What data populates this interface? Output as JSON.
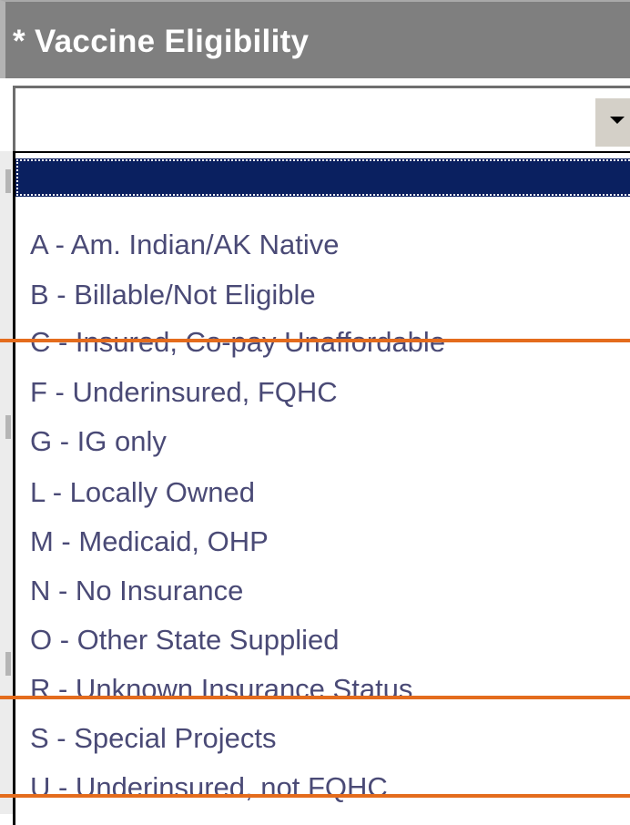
{
  "header": {
    "title": "* Vaccine Eligibility"
  },
  "select": {
    "value": "",
    "options": [
      {
        "label": "",
        "selected": true,
        "struck": false
      },
      {
        "label": "A - Am. Indian/AK Native",
        "selected": false,
        "struck": false
      },
      {
        "label": "B - Billable/Not Eligible",
        "selected": false,
        "struck": false
      },
      {
        "label": "C - Insured, Co-pay Unaffordable",
        "selected": false,
        "struck": true
      },
      {
        "label": "F - Underinsured, FQHC",
        "selected": false,
        "struck": false
      },
      {
        "label": "G - IG only",
        "selected": false,
        "struck": false
      },
      {
        "label": "L - Locally Owned",
        "selected": false,
        "struck": false
      },
      {
        "label": "M - Medicaid, OHP",
        "selected": false,
        "struck": false
      },
      {
        "label": "N - No Insurance",
        "selected": false,
        "struck": false
      },
      {
        "label": "O - Other State Supplied",
        "selected": false,
        "struck": false
      },
      {
        "label": "R - Unknown Insurance Status",
        "selected": false,
        "struck": true
      },
      {
        "label": "S - Special Projects",
        "selected": false,
        "struck": false
      },
      {
        "label": "U - Underinsured, not FQHC",
        "selected": false,
        "struck": true
      }
    ]
  },
  "colors": {
    "header_bg": "#7f7f7f",
    "selected_bg": "#0a2060",
    "option_text": "#4a4a76",
    "strike": "#e46c1d"
  },
  "icons": {
    "dropdown": "chevron-down-icon"
  }
}
